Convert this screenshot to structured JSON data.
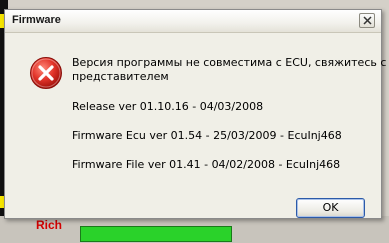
{
  "dialog": {
    "title": "Firmware",
    "icon": "error-icon",
    "message_line1": "Версия программы не совместима с ECU, свяжитесь с",
    "message_line2": "представителем",
    "release": "Release  ver 01.10.16 - 04/03/2008",
    "firmware_ecu": "Firmware Ecu  ver 01.54 - 25/03/2009 - EcuInj468",
    "firmware_file": "Firmware File ver 01.41 - 04/02/2008 - EcuInj468",
    "ok_label": "OK"
  },
  "background": {
    "partial_text": "Rich"
  },
  "colors": {
    "error_red": "#d9271c",
    "ok_border": "#2c5aa8",
    "status_green": "#2ad22a"
  }
}
